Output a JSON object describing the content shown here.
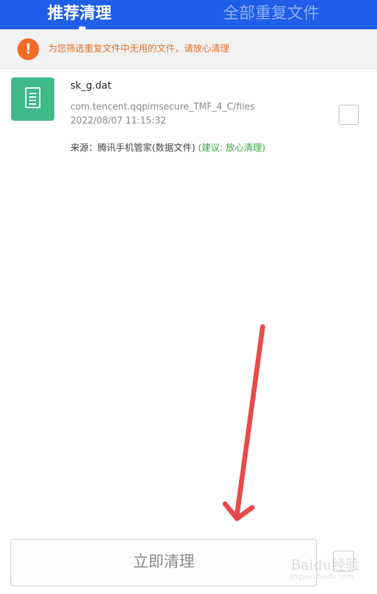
{
  "tabs": {
    "recommended": "推荐清理",
    "all_duplicates": "全部重复文件"
  },
  "notice": {
    "icon": "exclamation-icon",
    "text": "为您筛选重复文件中无用的文件，请放心清理"
  },
  "file": {
    "icon": "document-icon",
    "name": "sk_g.dat",
    "path": "com.tencent.qqpimsecure_TMF_4_C/files",
    "time": "2022/08/07 11:15:32",
    "source_prefix": "来源：腾讯手机管家(数据文件) ",
    "suggestion": "(建议: 放心清理)"
  },
  "actions": {
    "clean_now": "立即清理"
  },
  "watermark": {
    "brand": "Baidu经验",
    "url": "jingyan.baidu.com"
  },
  "colors": {
    "header": "#1f5ee8",
    "warning": "#f26a2a",
    "suggestion": "#35a83c",
    "file_icon": "#3eb98a",
    "arrow": "#e84a4a"
  }
}
